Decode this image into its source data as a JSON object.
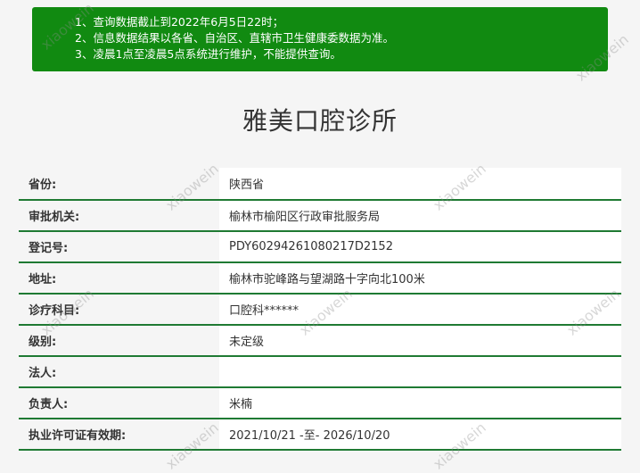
{
  "notice": {
    "lines": [
      "1、查询数据截止到2022年6月5日22时；",
      "2、信息数据结果以各省、自治区、直辖市卫生健康委数据为准。",
      "3、凌晨1点至凌晨5点系统进行维护，不能提供查询。"
    ]
  },
  "page_title": "雅美口腔诊所",
  "details": [
    {
      "label": "省份:",
      "value": "陕西省"
    },
    {
      "label": "审批机关:",
      "value": "榆林市榆阳区行政审批服务局"
    },
    {
      "label": "登记号:",
      "value": "PDY60294261080217D2152"
    },
    {
      "label": "地址:",
      "value": "榆林市驼峰路与望湖路十字向北100米"
    },
    {
      "label": "诊疗科目:",
      "value": "口腔科******"
    },
    {
      "label": "级别:",
      "value": "未定级"
    },
    {
      "label": "法人:",
      "value": ""
    },
    {
      "label": "负责人:",
      "value": "米楠"
    },
    {
      "label": "执业许可证有效期:",
      "value": "2021/10/21 -至- 2026/10/20"
    }
  ],
  "watermark": "xiaowein",
  "colors": {
    "notice_bg": "#118a11",
    "row_border": "#1f7a33"
  }
}
